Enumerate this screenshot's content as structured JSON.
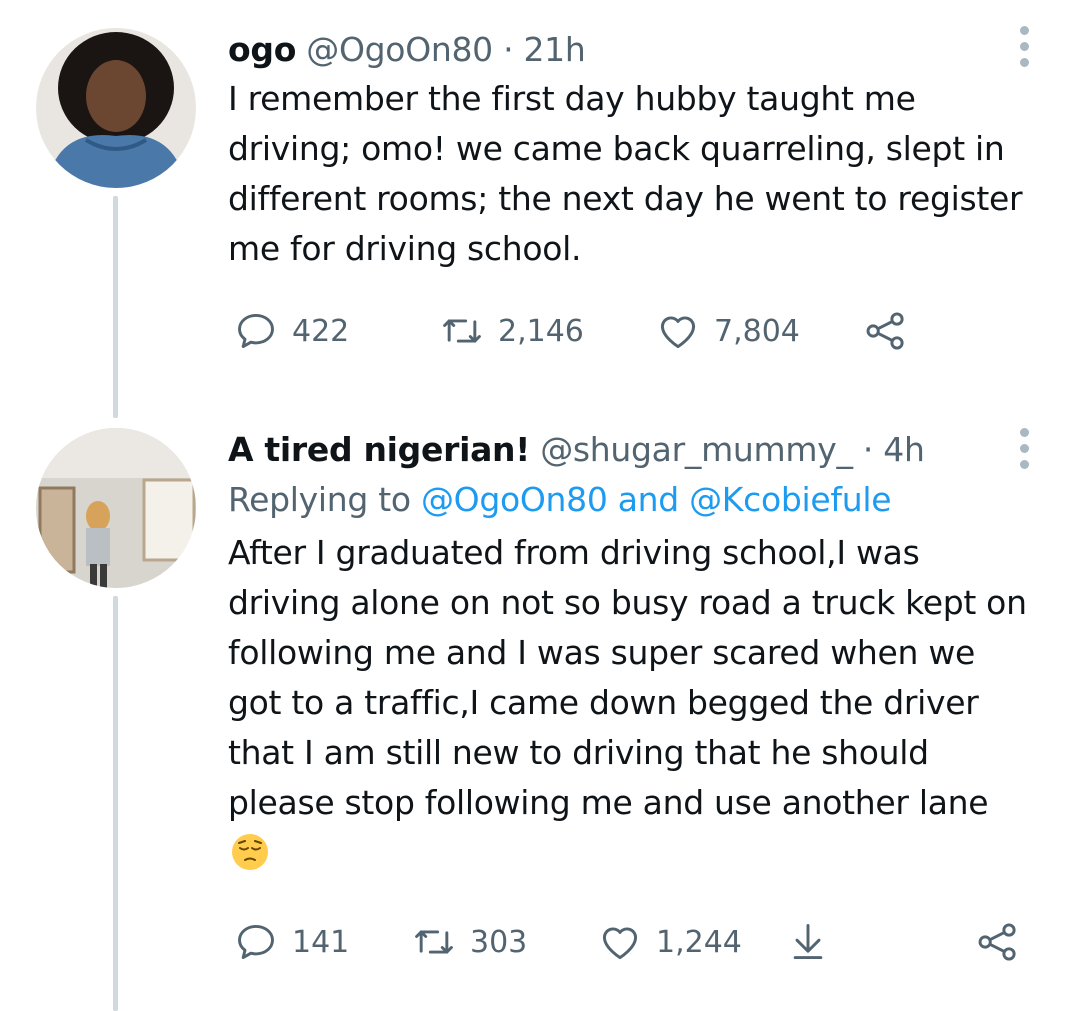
{
  "tweets": [
    {
      "name": "ogo",
      "handle": "@OgoOn80",
      "separator": "·",
      "time": "21h",
      "text": "I remember the first day hubby taught me driving; omo! we came back quarreling, slept in different rooms; the next day he went to register me for driving school.",
      "replies": "422",
      "retweets": "2,146",
      "likes": "7,804"
    },
    {
      "name": "A tired nigerian!",
      "handle": "@shugar_mummy_",
      "separator": "·",
      "time": "4h",
      "replying_label": "Replying to",
      "replying_mentions": "@OgoOn80 and @Kcobiefule",
      "text": "After I graduated from driving school,I was driving alone on not so busy road a truck kept on following me and I was super scared when we got to a traffic,I came down begged the driver that I am still new to driving that he should please stop following me and use another lane",
      "emoji": "pensive-face",
      "replies": "141",
      "retweets": "303",
      "likes": "1,244"
    }
  ],
  "colors": {
    "text": "#0f1419",
    "secondary": "#536471",
    "link": "#1d9bf0",
    "thread": "#cfd9de"
  }
}
